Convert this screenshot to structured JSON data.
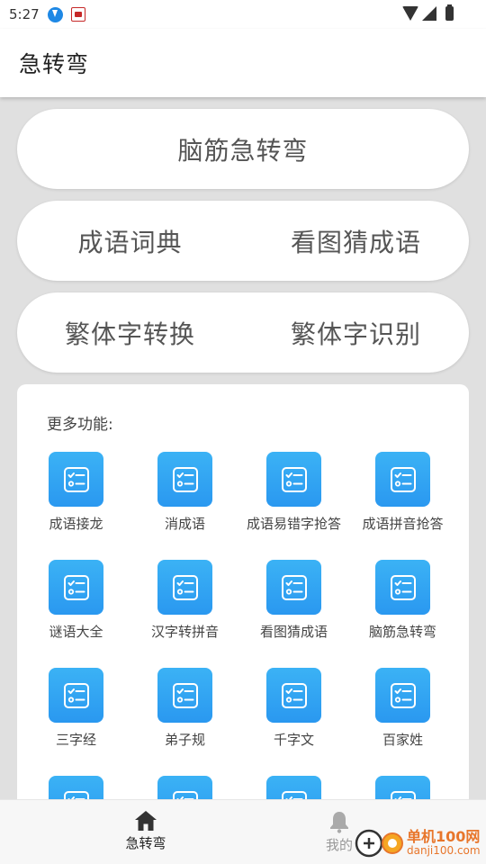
{
  "status_bar": {
    "time": "5:27",
    "icons": [
      "download-icon",
      "app-notification-icon",
      "wifi-icon",
      "cellular-icon",
      "battery-icon"
    ]
  },
  "app_bar": {
    "title": "急转弯"
  },
  "main_buttons": {
    "row1": {
      "label": "脑筋急转弯"
    },
    "row2": {
      "left": "成语词典",
      "right": "看图猜成语"
    },
    "row3": {
      "left": "繁体字转换",
      "right": "繁体字识别"
    }
  },
  "more_panel": {
    "title": "更多功能:",
    "items": [
      {
        "label": "成语接龙",
        "icon": "checklist-icon"
      },
      {
        "label": "消成语",
        "icon": "checklist-icon"
      },
      {
        "label": "成语易错字抢答",
        "icon": "checklist-icon"
      },
      {
        "label": "成语拼音抢答",
        "icon": "checklist-icon"
      },
      {
        "label": "谜语大全",
        "icon": "checklist-icon"
      },
      {
        "label": "汉字转拼音",
        "icon": "checklist-icon"
      },
      {
        "label": "看图猜成语",
        "icon": "checklist-icon"
      },
      {
        "label": "脑筋急转弯",
        "icon": "checklist-icon"
      },
      {
        "label": "三字经",
        "icon": "checklist-icon"
      },
      {
        "label": "弟子规",
        "icon": "checklist-icon"
      },
      {
        "label": "千字文",
        "icon": "checklist-icon"
      },
      {
        "label": "百家姓",
        "icon": "checklist-icon"
      },
      {
        "label": "",
        "icon": "checklist-icon"
      },
      {
        "label": "",
        "icon": "checklist-icon"
      },
      {
        "label": "",
        "icon": "checklist-icon"
      },
      {
        "label": "",
        "icon": "checklist-icon"
      }
    ]
  },
  "bottom_nav": {
    "home_label": "急转弯",
    "mine_label": "我的"
  },
  "watermark": {
    "cn": "单机100网",
    "en": "danji100.com"
  },
  "colors": {
    "accent": "#2a98f0",
    "background": "#e0e0e0",
    "watermark": "#e8762b"
  }
}
